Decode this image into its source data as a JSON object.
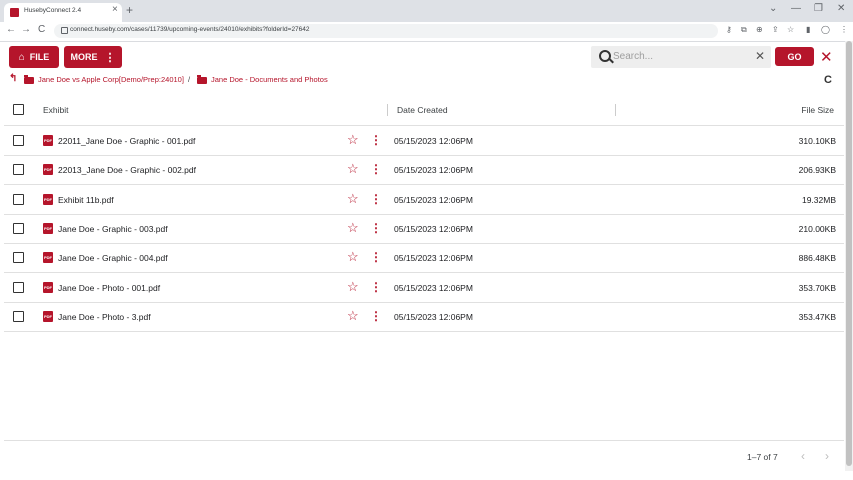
{
  "browser": {
    "tab_title": "HusebyConnect 2.4",
    "url": "connect.huseby.com/cases/11739/upcoming-events/24010/exhibits?folderId=27642",
    "tab_close": "×",
    "new_tab": "+",
    "win_chevron": "⌄",
    "win_min": "—",
    "win_max": "❐",
    "win_close": "✕",
    "back": "←",
    "forward": "→",
    "reload": "C",
    "menu": "⋮"
  },
  "toolbar": {
    "file_label": "FILE",
    "more_label": "MORE",
    "search_placeholder": "Search...",
    "search_clear": "✕",
    "go_label": "GO",
    "close_label": "✕"
  },
  "breadcrumb": {
    "items": [
      "Jane Doe vs Apple Corp[Demo/Prep:24010]",
      "Jane Doe - Documents and Photos"
    ],
    "separator": "/",
    "refresh_icon": "C"
  },
  "table": {
    "headers": {
      "exhibit": "Exhibit",
      "date_created": "Date Created",
      "file_size": "File Size"
    },
    "file_badge": "PDF",
    "rows": [
      {
        "name": "22011_Jane Doe - Graphic - 001.pdf",
        "date": "05/15/2023 12:06PM",
        "size": "310.10KB"
      },
      {
        "name": "22013_Jane Doe - Graphic - 002.pdf",
        "date": "05/15/2023 12:06PM",
        "size": "206.93KB"
      },
      {
        "name": "Exhibit 11b.pdf",
        "date": "05/15/2023 12:06PM",
        "size": "19.32MB"
      },
      {
        "name": "Jane Doe - Graphic - 003.pdf",
        "date": "05/15/2023 12:06PM",
        "size": "210.00KB"
      },
      {
        "name": "Jane Doe - Graphic - 004.pdf",
        "date": "05/15/2023 12:06PM",
        "size": "886.48KB"
      },
      {
        "name": "Jane Doe - Photo - 001.pdf",
        "date": "05/15/2023 12:06PM",
        "size": "353.70KB"
      },
      {
        "name": "Jane Doe - Photo - 3.pdf",
        "date": "05/15/2023 12:06PM",
        "size": "353.47KB"
      }
    ]
  },
  "pagination": {
    "label": "1–7 of 7",
    "prev": "‹",
    "next": "›"
  },
  "colors": {
    "accent": "#b5152b"
  }
}
